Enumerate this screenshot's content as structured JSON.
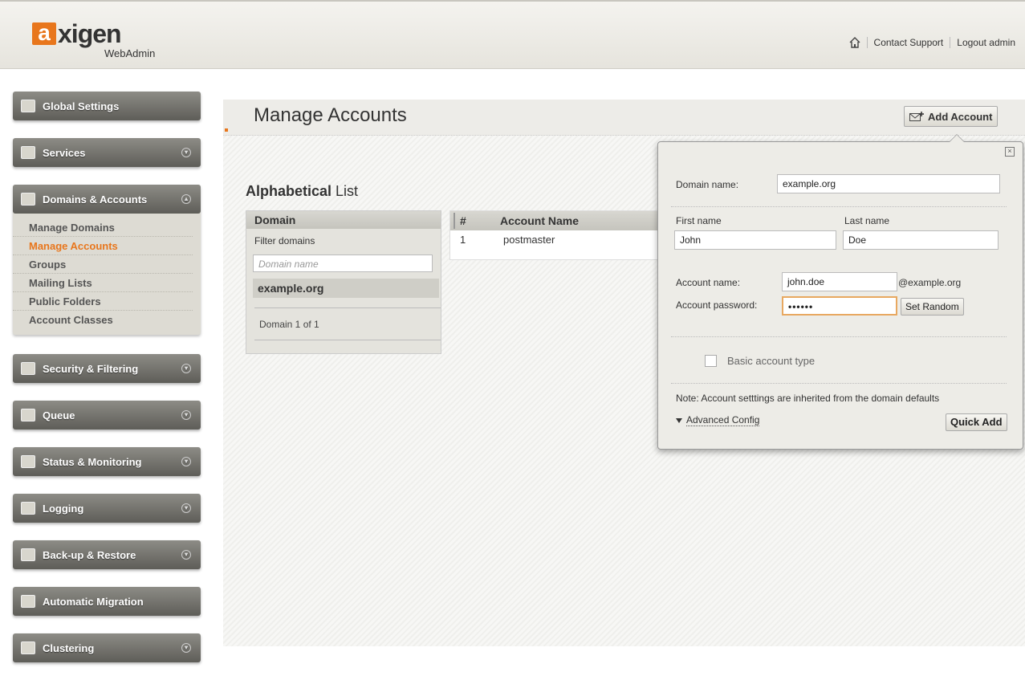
{
  "header": {
    "logo_letter": "a",
    "logo_text": "xigen",
    "logo_sub": "WebAdmin",
    "links": {
      "contact_support": "Contact Support",
      "logout": "Logout admin"
    }
  },
  "sidebar": {
    "items": [
      {
        "label": "Global Settings",
        "icon": "globe-icon"
      },
      {
        "label": "Services",
        "icon": "services-icon"
      },
      {
        "label": "Domains & Accounts",
        "icon": "domains-icon"
      },
      {
        "label": "Security & Filtering",
        "icon": "security-icon"
      },
      {
        "label": "Queue",
        "icon": "queue-icon"
      },
      {
        "label": "Status & Monitoring",
        "icon": "monitoring-icon"
      },
      {
        "label": "Logging",
        "icon": "logging-icon"
      },
      {
        "label": "Back-up & Restore",
        "icon": "backup-icon"
      },
      {
        "label": "Automatic Migration",
        "icon": "migration-icon"
      },
      {
        "label": "Clustering",
        "icon": "clustering-icon"
      }
    ],
    "subitems": [
      "Manage Domains",
      "Manage Accounts",
      "Groups",
      "Mailing Lists",
      "Public Folders",
      "Account Classes"
    ],
    "active_subitem": "Manage Accounts"
  },
  "main": {
    "title": "Manage Accounts",
    "add_account_label": "Add Account",
    "list_title_bold": "Alphabetical",
    "list_title_rest": " List",
    "domain_panel": {
      "header": "Domain",
      "filter_label": "Filter domains",
      "filter_placeholder": "Domain name",
      "selected_domain": "example.org",
      "count": "Domain 1 of 1"
    },
    "accounts_table": {
      "columns": [
        "#",
        "Account Name"
      ],
      "rows": [
        {
          "num": "1",
          "name": "postmaster"
        }
      ]
    }
  },
  "popup": {
    "domain_label": "Domain name:",
    "domain_value": "example.org",
    "first_name_label": "First name",
    "first_name_value": "John",
    "last_name_label": "Last name",
    "last_name_value": "Doe",
    "account_name_label": "Account name:",
    "account_name_value": "john.doe",
    "domain_suffix": "@example.org",
    "password_label": "Account password:",
    "password_value": "••••••",
    "set_random_label": "Set Random",
    "basic_type_label": "Basic account type",
    "note": "Note: Account setttings are inherited from the domain defaults",
    "advanced_label": "Advanced Config",
    "quick_add_label": "Quick Add"
  },
  "colors": {
    "accent": "#e8761c",
    "nav_button": "#6f6e69"
  }
}
